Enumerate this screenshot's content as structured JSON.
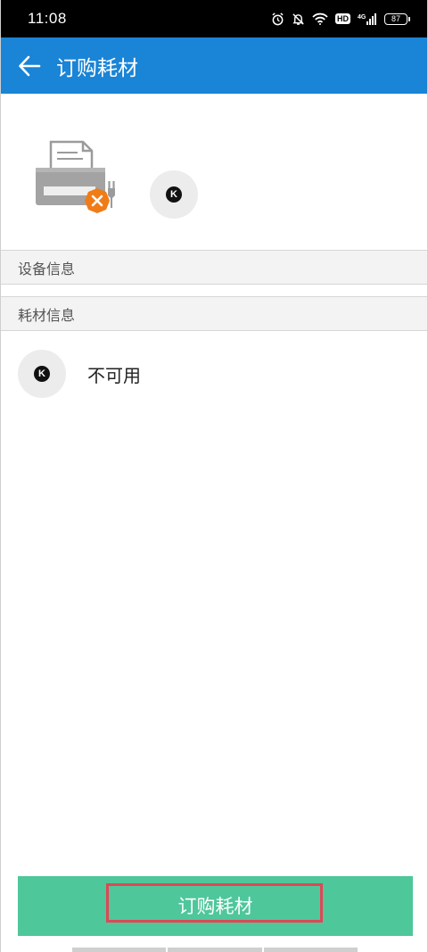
{
  "status_bar": {
    "time": "11:08",
    "hd_label": "HD",
    "network_label": "4G",
    "battery_level": "87",
    "icons": [
      "alarm-icon",
      "mute-icon",
      "wifi-icon",
      "hd-icon",
      "signal-icon",
      "battery-icon"
    ]
  },
  "app_bar": {
    "title": "订购耗材",
    "back_icon": "arrow-left-icon",
    "color": "#1a84d6"
  },
  "printer": {
    "status_icon": "printer-error-icon",
    "error_badge_color": "#f07c18",
    "ink_label": "K"
  },
  "sections": {
    "device_info": "设备信息",
    "supply_info": "耗材信息"
  },
  "supplies": [
    {
      "ink_label": "K",
      "status": "不可用"
    }
  ],
  "order_button": {
    "label": "订购耗材",
    "color": "#4ec79a",
    "highlight_color": "#e04655"
  }
}
